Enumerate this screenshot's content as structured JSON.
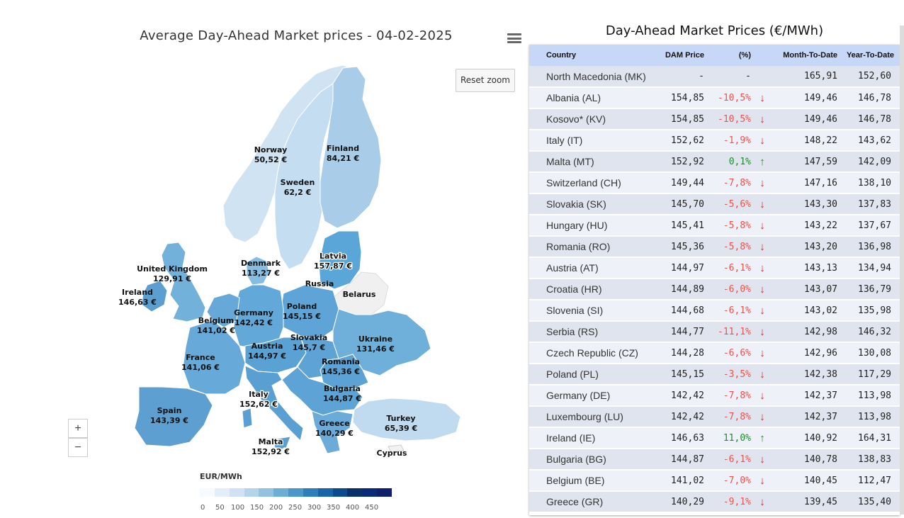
{
  "map": {
    "title": "Average Day-Ahead Market prices - 04-02-2025",
    "menu_icon": "hamburger-icon",
    "reset_zoom_label": "Reset zoom",
    "zoom_in_label": "+",
    "zoom_out_label": "−",
    "labels": [
      {
        "name": "Norway",
        "value": "50,52 €"
      },
      {
        "name": "Finland",
        "value": "84,21 €"
      },
      {
        "name": "Sweden",
        "value": "62,2 €"
      },
      {
        "name": "Latvia",
        "value": "157,87 €"
      },
      {
        "name": "United Kingdom",
        "value": "129,91 €"
      },
      {
        "name": "Denmark",
        "value": "113,27 €"
      },
      {
        "name": "Ireland",
        "value": "146,63 €"
      },
      {
        "name": "Russia",
        "value": ""
      },
      {
        "name": "Belarus",
        "value": ""
      },
      {
        "name": "Poland",
        "value": "145,15 €"
      },
      {
        "name": "Germany",
        "value": "142,42 €"
      },
      {
        "name": "Belgium",
        "value": "141,02 €"
      },
      {
        "name": "Ukraine",
        "value": "131,46 €"
      },
      {
        "name": "Slovakia",
        "value": "145,7 €"
      },
      {
        "name": "Austria",
        "value": "144,97 €"
      },
      {
        "name": "France",
        "value": "141,06 €"
      },
      {
        "name": "Romania",
        "value": "145,36 €"
      },
      {
        "name": "Bulgaria",
        "value": "144,87 €"
      },
      {
        "name": "Italy",
        "value": "152,62 €"
      },
      {
        "name": "Spain",
        "value": "143,39 €"
      },
      {
        "name": "Turkey",
        "value": "65,39 €"
      },
      {
        "name": "Greece",
        "value": "140,29 €"
      },
      {
        "name": "Cyprus",
        "value": ""
      },
      {
        "name": "Malta",
        "value": "152,92 €"
      }
    ],
    "legend": {
      "title": "EUR/MWh",
      "ticks": [
        "0",
        "50",
        "100",
        "150",
        "200",
        "250",
        "300",
        "350",
        "400",
        "450"
      ],
      "colors": [
        "#f7fbff",
        "#e3eef9",
        "#cfe1f2",
        "#b5d4e9",
        "#93c3df",
        "#6daed5",
        "#4b97c9",
        "#2f7ebc",
        "#1864aa",
        "#0a4a90",
        "#08306b",
        "#0a2a78",
        "#0d1f6d"
      ]
    },
    "colors": {
      "no_data": "#f2f2f2",
      "border": "#ffffff"
    }
  },
  "table": {
    "title": "Day-Ahead Market Prices (€/MWh)",
    "headers": {
      "country": "Country",
      "dam": "DAM Price",
      "pct": "(%)",
      "mtd": "Month-To-Date",
      "ytd": "Year-To-Date"
    },
    "rows": [
      {
        "country": "North Macedonia (MK)",
        "dam": "-",
        "pct": "-",
        "trend": "none",
        "mtd": "165,91",
        "ytd": "152,60"
      },
      {
        "country": "Albania (AL)",
        "dam": "154,85",
        "pct": "-10,5%",
        "trend": "down",
        "mtd": "149,46",
        "ytd": "146,78"
      },
      {
        "country": "Kosovo* (KV)",
        "dam": "154,85",
        "pct": "-10,5%",
        "trend": "down",
        "mtd": "149,46",
        "ytd": "146,78"
      },
      {
        "country": "Italy (IT)",
        "dam": "152,62",
        "pct": "-1,9%",
        "trend": "down",
        "mtd": "148,22",
        "ytd": "143,62"
      },
      {
        "country": "Malta (MT)",
        "dam": "152,92",
        "pct": "0,1%",
        "trend": "up",
        "mtd": "147,59",
        "ytd": "142,09"
      },
      {
        "country": "Switzerland (CH)",
        "dam": "149,44",
        "pct": "-7,8%",
        "trend": "down",
        "mtd": "147,16",
        "ytd": "138,10"
      },
      {
        "country": "Slovakia (SK)",
        "dam": "145,70",
        "pct": "-5,6%",
        "trend": "down",
        "mtd": "143,30",
        "ytd": "137,83"
      },
      {
        "country": "Hungary (HU)",
        "dam": "145,41",
        "pct": "-5,8%",
        "trend": "down",
        "mtd": "143,22",
        "ytd": "137,67"
      },
      {
        "country": "Romania (RO)",
        "dam": "145,36",
        "pct": "-5,8%",
        "trend": "down",
        "mtd": "143,20",
        "ytd": "136,98"
      },
      {
        "country": "Austria (AT)",
        "dam": "144,97",
        "pct": "-6,1%",
        "trend": "down",
        "mtd": "143,13",
        "ytd": "134,94"
      },
      {
        "country": "Croatia (HR)",
        "dam": "144,89",
        "pct": "-6,0%",
        "trend": "down",
        "mtd": "143,07",
        "ytd": "136,79"
      },
      {
        "country": "Slovenia (SI)",
        "dam": "144,68",
        "pct": "-6,1%",
        "trend": "down",
        "mtd": "143,02",
        "ytd": "135,98"
      },
      {
        "country": "Serbia (RS)",
        "dam": "144,77",
        "pct": "-11,1%",
        "trend": "down",
        "mtd": "142,98",
        "ytd": "146,32"
      },
      {
        "country": "Czech Republic (CZ)",
        "dam": "144,28",
        "pct": "-6,6%",
        "trend": "down",
        "mtd": "142,96",
        "ytd": "130,08"
      },
      {
        "country": "Poland (PL)",
        "dam": "145,15",
        "pct": "-3,5%",
        "trend": "down",
        "mtd": "142,38",
        "ytd": "117,29"
      },
      {
        "country": "Germany (DE)",
        "dam": "142,42",
        "pct": "-7,8%",
        "trend": "down",
        "mtd": "142,37",
        "ytd": "113,98"
      },
      {
        "country": "Luxembourg (LU)",
        "dam": "142,42",
        "pct": "-7,8%",
        "trend": "down",
        "mtd": "142,37",
        "ytd": "113,98"
      },
      {
        "country": "Ireland (IE)",
        "dam": "146,63",
        "pct": "11,0%",
        "trend": "up",
        "mtd": "140,92",
        "ytd": "164,31"
      },
      {
        "country": "Bulgaria (BG)",
        "dam": "144,87",
        "pct": "-6,1%",
        "trend": "down",
        "mtd": "140,78",
        "ytd": "138,83"
      },
      {
        "country": "Belgium (BE)",
        "dam": "141,02",
        "pct": "-7,0%",
        "trend": "down",
        "mtd": "140,45",
        "ytd": "112,47"
      },
      {
        "country": "Greece (GR)",
        "dam": "140,29",
        "pct": "-9,1%",
        "trend": "down",
        "mtd": "139,45",
        "ytd": "135,40"
      }
    ],
    "arrow_icons": {
      "down": "arrow-down-icon",
      "up": "arrow-up-icon"
    },
    "colors": {
      "header_bg": "#c7d7f8",
      "down": "#e8534f",
      "up": "#1b8c2a"
    }
  }
}
